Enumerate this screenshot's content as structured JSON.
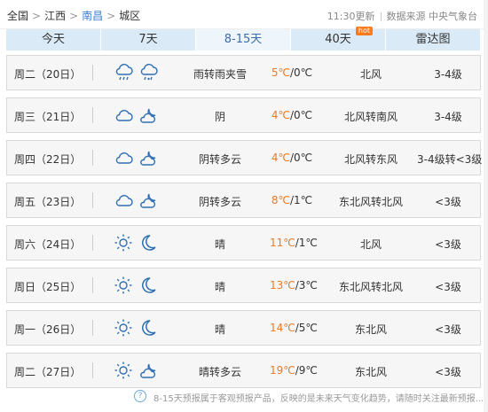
{
  "breadcrumb": {
    "country": "全国",
    "province": "江西",
    "city": "南昌",
    "district": "城区"
  },
  "meta": {
    "update_time": "11:30更新",
    "source": "数据来源 中央气象台"
  },
  "tabs": [
    {
      "label": "今天"
    },
    {
      "label": "7天"
    },
    {
      "label": "8-15天",
      "active": true
    },
    {
      "label": "40天",
      "badge": "hot"
    },
    {
      "label": "雷达图"
    }
  ],
  "days": [
    {
      "date": "周二（20日）",
      "icon_day": "rain-cloud-icon",
      "icon_night": "sleet-cloud-icon",
      "desc": "雨转雨夹雪",
      "high": "5℃",
      "low": "/0℃",
      "wind": "北风",
      "level": "3-4级"
    },
    {
      "date": "周三（21日）",
      "icon_day": "cloud-icon",
      "icon_night": "moon-cloud-icon",
      "desc": "阴",
      "high": "4℃",
      "low": "/0℃",
      "wind": "北风转南风",
      "level": "3-4级"
    },
    {
      "date": "周四（22日）",
      "icon_day": "cloud-icon",
      "icon_night": "moon-cloud-icon",
      "desc": "阴转多云",
      "high": "4℃",
      "low": "/0℃",
      "wind": "北风转东风",
      "level": "3-4级转<3级"
    },
    {
      "date": "周五（23日）",
      "icon_day": "cloud-icon",
      "icon_night": "moon-cloud-icon",
      "desc": "阴转多云",
      "high": "8℃",
      "low": "/1℃",
      "wind": "东北风转北风",
      "level": "<3级"
    },
    {
      "date": "周六（24日）",
      "icon_day": "sun-icon",
      "icon_night": "moon-icon",
      "desc": "晴",
      "high": "11℃",
      "low": "/1℃",
      "wind": "北风",
      "level": "<3级"
    },
    {
      "date": "周日（25日）",
      "icon_day": "sun-icon",
      "icon_night": "moon-icon",
      "desc": "晴",
      "high": "13℃",
      "low": "/3℃",
      "wind": "东北风转北风",
      "level": "<3级"
    },
    {
      "date": "周一（26日）",
      "icon_day": "sun-icon",
      "icon_night": "moon-icon",
      "desc": "晴",
      "high": "14℃",
      "low": "/5℃",
      "wind": "东北风",
      "level": "<3级"
    },
    {
      "date": "周二（27日）",
      "icon_day": "sun-icon",
      "icon_night": "moon-cloud-icon",
      "desc": "晴转多云",
      "high": "19℃",
      "low": "/9℃",
      "wind": "东北风",
      "level": "<3级"
    }
  ],
  "footer": {
    "note": "8-15天预报属于客观预报产品，反映的是未来天气变化趋势，请随时关注最新预报..."
  },
  "colors": {
    "accent": "#3b7fd6",
    "temp_high": "#f07820",
    "tab_bg": "#daeaf7",
    "icon": "#2f6fb3"
  }
}
